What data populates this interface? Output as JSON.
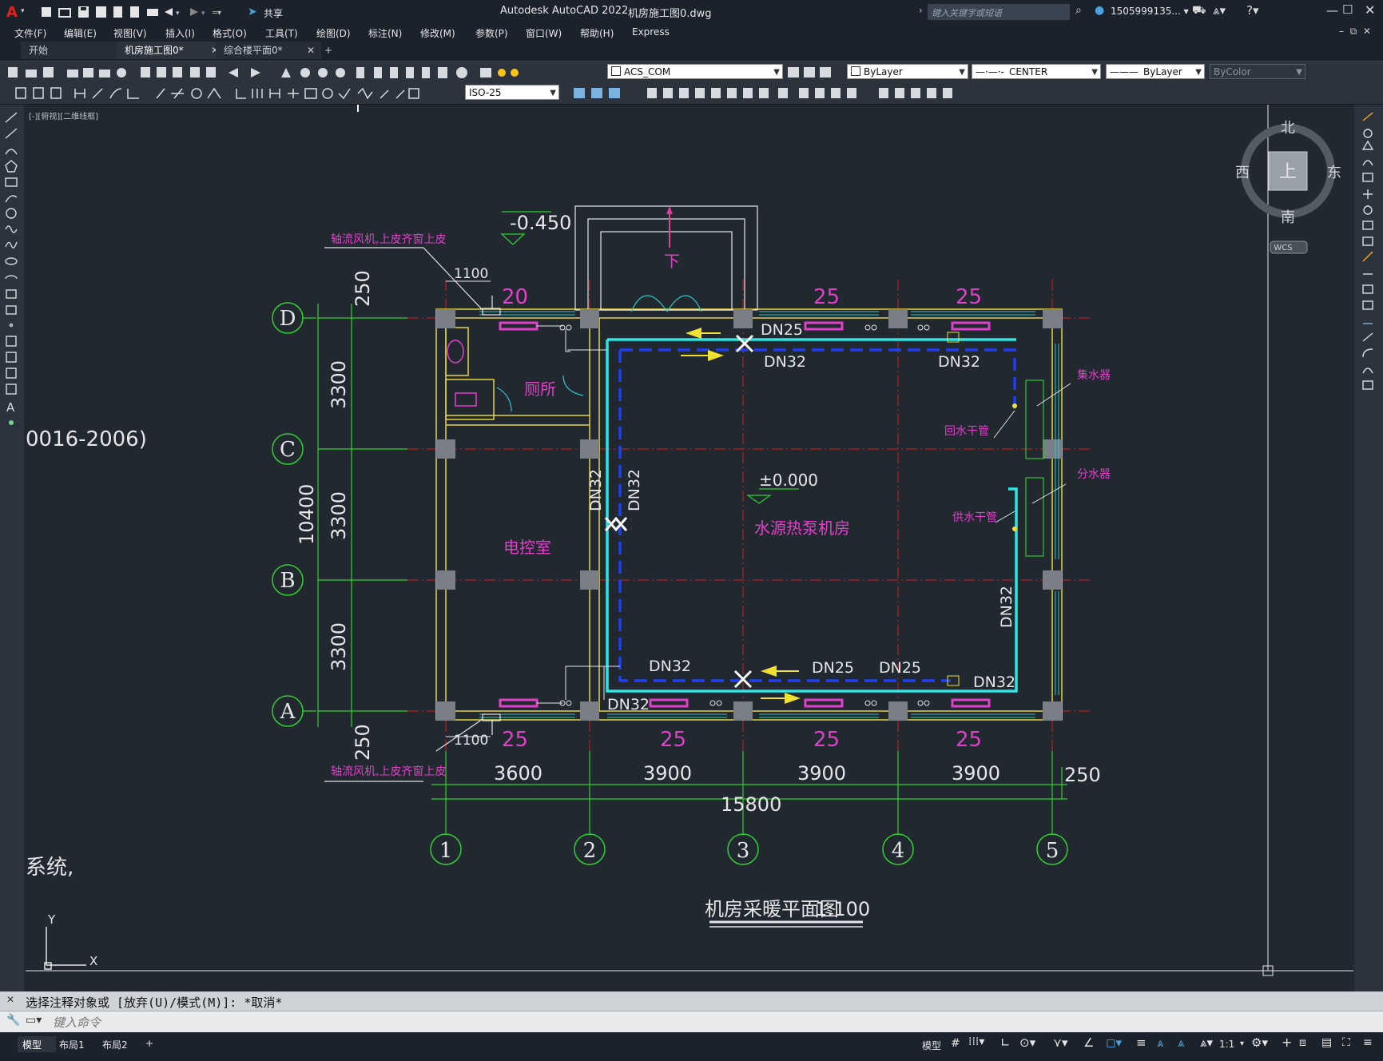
{
  "app": {
    "title": "Autodesk AutoCAD 2022",
    "file": "机房施工图0.dwg",
    "share": "共享",
    "search_placeholder": "键入关键字或短语",
    "user": "1505999135... ▾"
  },
  "menu": [
    "文件(F)",
    "编辑(E)",
    "视图(V)",
    "插入(I)",
    "格式(O)",
    "工具(T)",
    "绘图(D)",
    "标注(N)",
    "修改(M)",
    "参数(P)",
    "窗口(W)",
    "帮助(H)",
    "Express"
  ],
  "tabs": [
    "开始",
    "机房施工图0*",
    "综合楼平面0*",
    "+"
  ],
  "toolbar": {
    "layer": "ACS_COM",
    "color": "ByLayer",
    "linetype": "CENTER",
    "lineweight": "ByLayer",
    "plotstyle": "ByColor",
    "dimstyle": "ISO-25"
  },
  "viewport_label": "[-][俯视][二维线框]",
  "viewcube": {
    "north": "北",
    "south": "南",
    "east": "东",
    "west": "西",
    "top": "上",
    "wcs": "WCS"
  },
  "drawing": {
    "title": "机房采暖平面图",
    "scale": "1:100",
    "rooms": {
      "toilet": "厕所",
      "control": "电控室",
      "pump": "水源热泵机房"
    },
    "levels": {
      "outdoor": "-0.450",
      "floor": "±0.000"
    },
    "stair_down": "下",
    "fan_note": "轴流风机,上皮齐窗上皮",
    "fan_dim": "1100",
    "collector": "集水器",
    "distributor": "分水器",
    "return_main": "回水干管",
    "supply_main": "供水干管",
    "radiator_counts_top": [
      "20",
      "25",
      "25"
    ],
    "radiator_counts_bottom": [
      "25",
      "25",
      "25",
      "25"
    ],
    "pipes": [
      "DN25",
      "DN32",
      "DN32",
      "DN32",
      "DN32",
      "DN32",
      "DN25",
      "DN25",
      "DN32",
      "DN32",
      "DN32"
    ],
    "row_axes": [
      "D",
      "C",
      "B",
      "A"
    ],
    "col_axes": [
      "1",
      "2",
      "3",
      "4",
      "5"
    ],
    "row_dims": [
      "250",
      "3300",
      "3300",
      "3300",
      "250"
    ],
    "row_total": "10400",
    "col_dims": [
      "3600",
      "3900",
      "3900",
      "3900",
      "250"
    ],
    "col_total": "15800",
    "partial_left_1": "0016-2006)",
    "partial_left_2": "系统,"
  },
  "command": {
    "history": "选择注释对象或 [放弃(U)/模式(M)]: *取消*",
    "placeholder": "键入命令"
  },
  "status": {
    "layouts": [
      "模型",
      "布局1",
      "布局2",
      "+"
    ],
    "model": "模型",
    "scale": "1:1"
  }
}
